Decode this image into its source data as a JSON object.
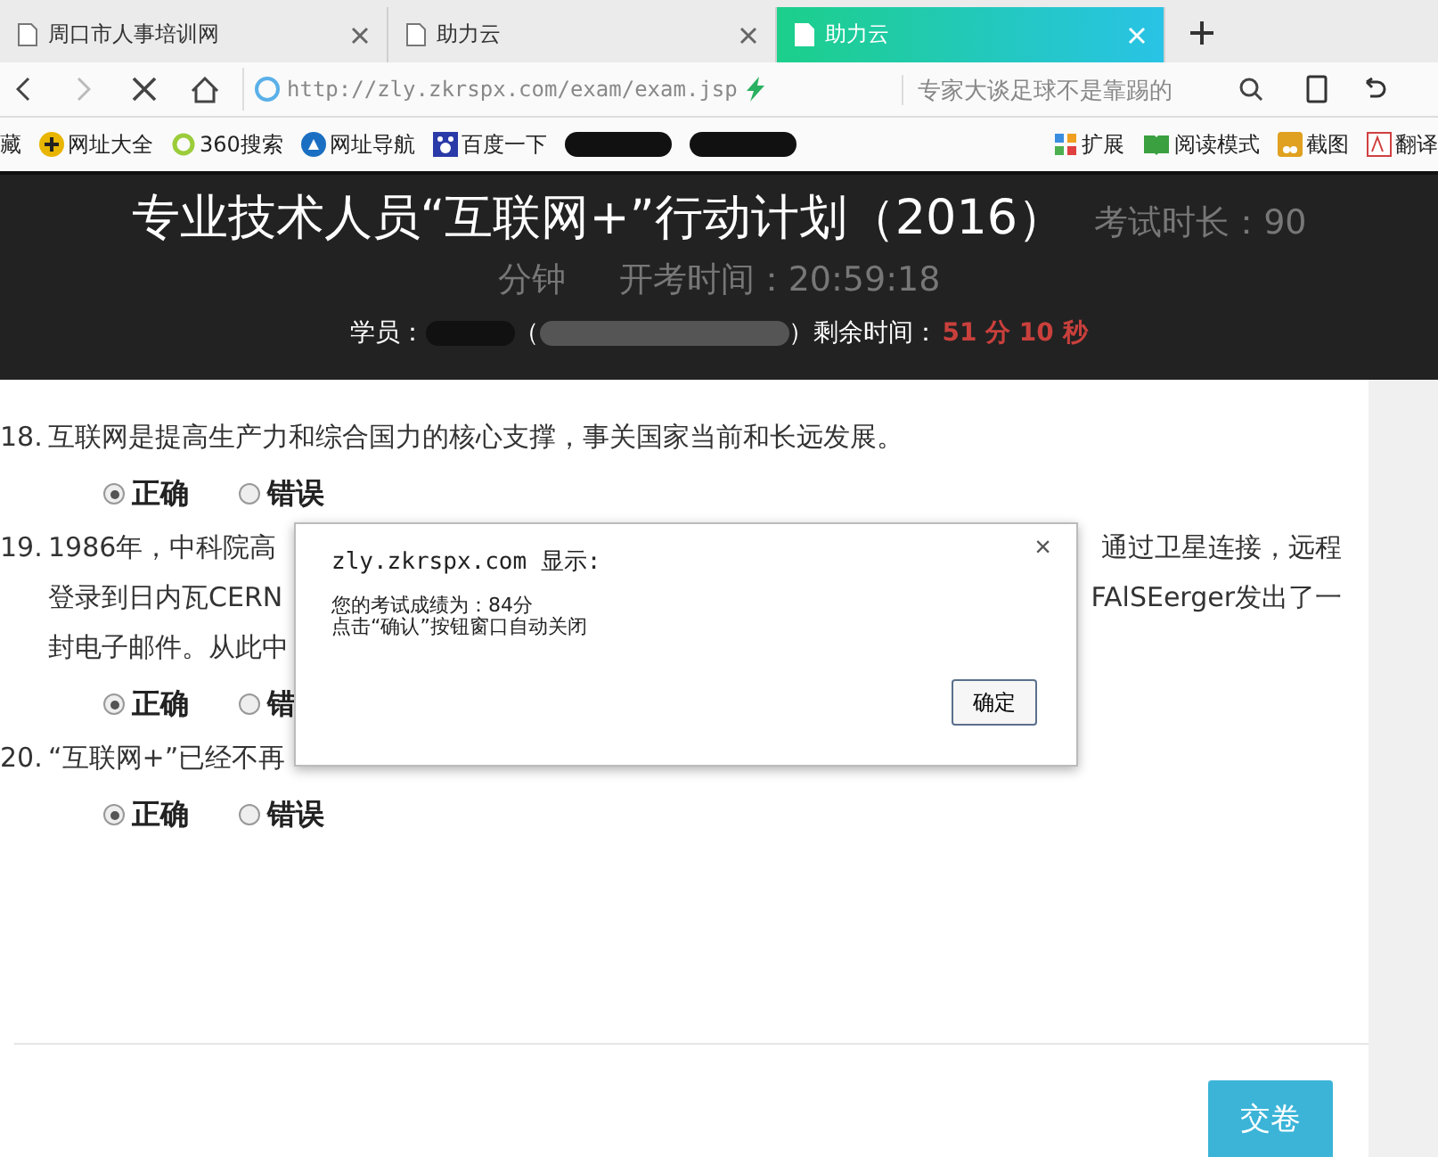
{
  "tabs": [
    {
      "label": "周口市人事培训网",
      "selected": false
    },
    {
      "label": "助力云",
      "selected": false
    },
    {
      "label": "助力云",
      "selected": true
    }
  ],
  "address_bar": {
    "url": "http://zly.zkrspx.com/exam/exam.jsp",
    "search_placeholder": "专家大谈足球不是靠踢的"
  },
  "bookmarks": [
    {
      "label": "藏",
      "kind": "text"
    },
    {
      "label": "网址大全",
      "kind": "plus"
    },
    {
      "label": "360搜索",
      "kind": "ring"
    },
    {
      "label": "网址导航",
      "kind": "s"
    },
    {
      "label": "百度一下",
      "kind": "paw"
    },
    {
      "kind": "redacted"
    },
    {
      "kind": "redacted"
    }
  ],
  "bookmark_tools": [
    {
      "label": "扩展",
      "kind": "grid"
    },
    {
      "label": "阅读模式",
      "kind": "book"
    },
    {
      "label": "截图",
      "kind": "scissors"
    },
    {
      "label": "翻译",
      "kind": "translate"
    }
  ],
  "exam_header": {
    "title": "专业技术人员“互联网+”行动计划（2016）",
    "duration_label": "考试时长：90",
    "duration_unit": "分钟",
    "start_time": "开考时间：20:59:18",
    "student_label": "学员：",
    "id_open": "（",
    "id_close": "）",
    "remaining_label": "剩余时间：",
    "remaining_time": "51 分 10 秒"
  },
  "questions": [
    {
      "number": "18.",
      "lines": [
        [
          "互联网是提高生产力和综合国力的核心支撑，事关国家当前和长远发展。"
        ]
      ],
      "options": [
        {
          "label": "正确",
          "selected": true
        },
        {
          "label": "错误",
          "selected": false
        }
      ]
    },
    {
      "number": "19.",
      "lines": [
        [
          "1986年，中科院高",
          "通过卫星连接，远程"
        ],
        [
          "登录到日内瓦CERN",
          "FAlSEerger发出了一"
        ],
        [
          "封电子邮件。从此中"
        ]
      ],
      "options": [
        {
          "label": "正确",
          "selected": true
        },
        {
          "label": "错",
          "selected": false
        }
      ]
    },
    {
      "number": "20.",
      "lines": [
        [
          "“互联网+”已经不再"
        ]
      ],
      "options": [
        {
          "label": "正确",
          "selected": true
        },
        {
          "label": "错误",
          "selected": false
        }
      ]
    }
  ],
  "submit_button": "交卷",
  "dialog": {
    "title": "zly.zkrspx.com 显示:",
    "message": [
      "您的考试成绩为：84分",
      "点击“确认”按钮窗口自动关闭"
    ],
    "close": "×",
    "ok_button": "确定"
  }
}
